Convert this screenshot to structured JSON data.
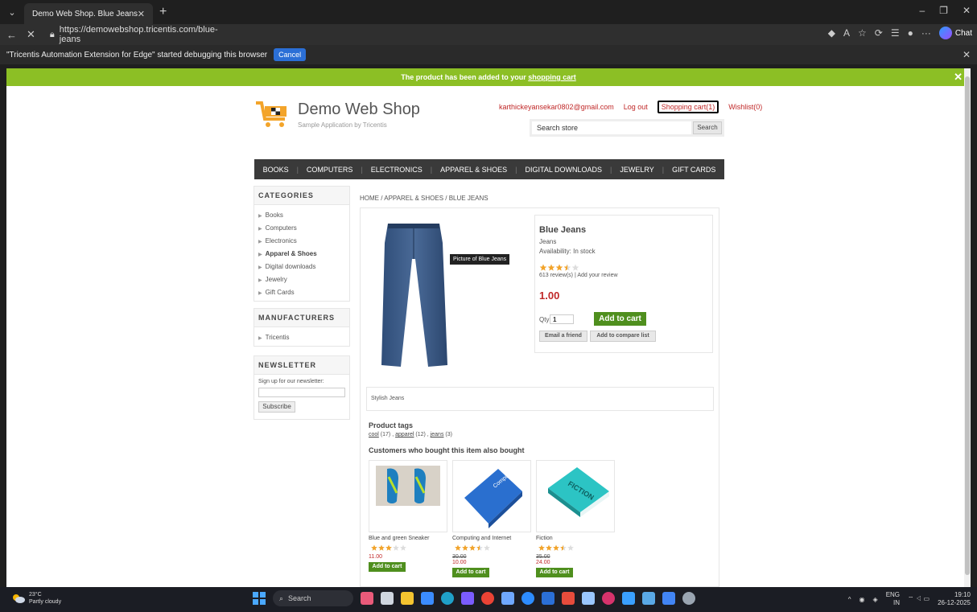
{
  "browser": {
    "tab_title": "Demo Web Shop. Blue Jeans",
    "url": "https://demowebshop.tricentis.com/blue-jeans",
    "chat_label": "Chat",
    "debug_message": "\"Tricentis Automation Extension for Edge\" started debugging this browser",
    "debug_cancel": "Cancel"
  },
  "notification": {
    "text": "The product has been added to your ",
    "link": "shopping cart"
  },
  "header": {
    "logo_title": "Demo Web Shop",
    "logo_subtitle": "Sample Application by Tricentis",
    "email": "karthickeyansekar0802@gmail.com",
    "logout": "Log out",
    "cart": "Shopping cart(1)",
    "wishlist": "Wishlist(0)",
    "search_placeholder": "Search store",
    "search_button": "Search"
  },
  "top_menu": [
    "BOOKS",
    "COMPUTERS",
    "ELECTRONICS",
    "APPAREL & SHOES",
    "DIGITAL DOWNLOADS",
    "JEWELRY",
    "GIFT CARDS"
  ],
  "sidebar": {
    "categories_title": "CATEGORIES",
    "categories": [
      "Books",
      "Computers",
      "Electronics",
      "Apparel & Shoes",
      "Digital downloads",
      "Jewelry",
      "Gift Cards"
    ],
    "manufacturers_title": "MANUFACTURERS",
    "manufacturers": [
      "Tricentis"
    ],
    "newsletter_title": "NEWSLETTER",
    "newsletter_label": "Sign up for our newsletter:",
    "subscribe": "Subscribe"
  },
  "breadcrumb": "HOME / APPAREL & SHOES / BLUE JEANS",
  "product": {
    "image_tooltip": "Picture of Blue Jeans",
    "name": "Blue Jeans",
    "short_desc": "Jeans",
    "availability": "Availability: In stock",
    "rating_stars": 3.5,
    "reviews": "613 review(s)  |  Add your review",
    "price": "1.00",
    "qty_label": "Qty:",
    "qty_value": "1",
    "add_to_cart": "Add to cart",
    "email_friend": "Email a friend",
    "compare": "Add to compare list",
    "full_desc": "Stylish Jeans"
  },
  "tags": {
    "title": "Product tags",
    "items": [
      {
        "name": "cool",
        "count": "(17)"
      },
      {
        "name": "apparel",
        "count": "(12)"
      },
      {
        "name": "jeans",
        "count": "(3)"
      }
    ]
  },
  "also_bought": {
    "title": "Customers who bought this item also bought",
    "items": [
      {
        "name": "Blue and green Sneaker",
        "old_price": "",
        "price": "11.00",
        "stars": 3,
        "add": "Add to cart"
      },
      {
        "name": "Computing and Internet",
        "old_price": "30.00",
        "price": "10.00",
        "stars": 3.5,
        "add": "Add to cart"
      },
      {
        "name": "Fiction",
        "old_price": "35.00",
        "price": "24.00",
        "stars": 3.5,
        "add": "Add to cart"
      }
    ]
  },
  "book_covers": {
    "computing": "Computing And Internet",
    "fiction": "FICTION"
  },
  "taskbar": {
    "temperature": "23°C",
    "weather": "Partly cloudy",
    "search": "Search",
    "lang": "ENG",
    "region": "IN",
    "time": "19:10",
    "date": "26-12-2025"
  },
  "colors": {
    "accent_green": "#8cbf25",
    "button_green": "#4f8f1e",
    "price_red": "#c02828",
    "menu_dark": "#3a3a3a"
  }
}
